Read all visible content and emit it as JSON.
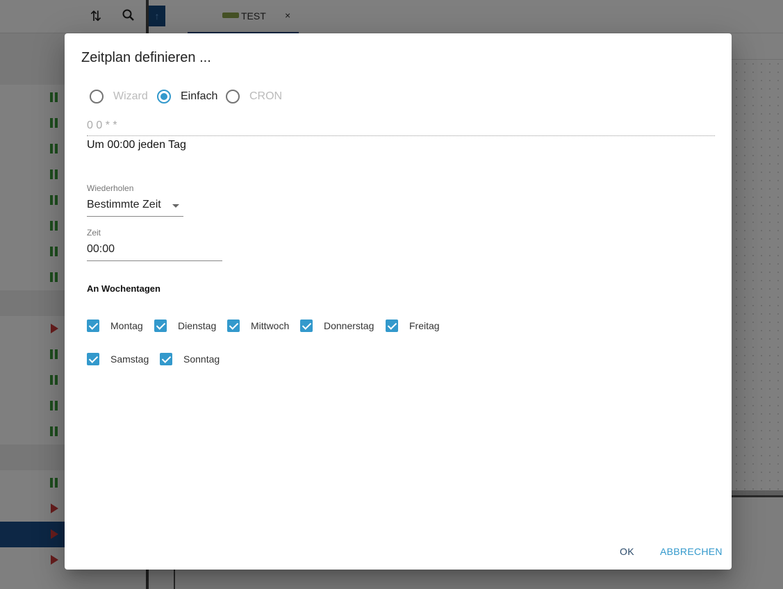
{
  "background": {
    "tab": {
      "label": "TEST",
      "close": "×"
    }
  },
  "dialog": {
    "title": "Zeitplan definieren ...",
    "modes": [
      {
        "label": "Wizard",
        "checked": false
      },
      {
        "label": "Einfach",
        "checked": true
      },
      {
        "label": "CRON",
        "checked": false
      }
    ],
    "cron_expression": "0 0 * *",
    "cron_description": "Um 00:00 jeden Tag",
    "repeat": {
      "label": "Wiederholen",
      "value": "Bestimmte Zeit"
    },
    "time": {
      "label": "Zeit",
      "value": "00:00"
    },
    "weekdays": {
      "title": "An Wochentagen",
      "days": [
        {
          "label": "Montag",
          "checked": true
        },
        {
          "label": "Dienstag",
          "checked": true
        },
        {
          "label": "Mittwoch",
          "checked": true
        },
        {
          "label": "Donnerstag",
          "checked": true
        },
        {
          "label": "Freitag",
          "checked": true
        },
        {
          "label": "Samstag",
          "checked": true
        },
        {
          "label": "Sonntag",
          "checked": true
        }
      ]
    },
    "buttons": {
      "ok": "OK",
      "cancel": "ABBRECHEN"
    }
  },
  "colors": {
    "accent": "#3399cc",
    "primary_dark": "#164a80",
    "running": "#3c9a3c",
    "stopped": "#d23c3c"
  }
}
